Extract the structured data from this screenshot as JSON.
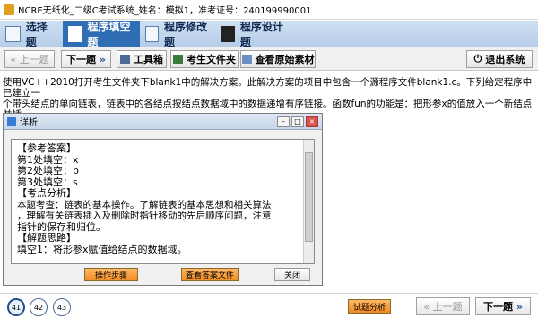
{
  "window": {
    "title": "NCRE无纸化_二级C考试系统_姓名：模拟1，准考证号：240199990001"
  },
  "tabs": [
    {
      "label": "选择题",
      "active": false
    },
    {
      "label": "程序填空题",
      "active": true
    },
    {
      "label": "程序修改题",
      "active": false
    },
    {
      "label": "程序设计题",
      "active": false
    }
  ],
  "toolbar": {
    "prev_label": "上一题",
    "next_label": "下一题",
    "toolbox_label": "工具箱",
    "student_folder_label": "考生文件夹",
    "view_source_label": "查看原始素材",
    "exit_label": "退出系统"
  },
  "problem": {
    "line1": "使用VC++2010打开考生文件夹下blank1中的解决方案。此解决方案的项目中包含一个源程序文件blank1.c。下列给定程序中已建立一",
    "line2": "个带头结点的单向链表，链表中的各结点按结点数据域中的数据递增有序链接。函数fun的功能是：把形参x的值放入一个新结点并插",
    "line3": "入链表中，使插入后各结点数据域中的数据仍保持递增有序。"
  },
  "dialog": {
    "title": "详析",
    "lines": [
      "【参考答案】",
      "第1处填空：x",
      "第2处填空：p",
      "第3处填空：s",
      "【考点分析】",
      "本题考查：链表的基本操作。了解链表的基本思想和相关算法",
      "，理解有关链表插入及删除时指针移动的先后顺序问题，注意",
      "指针的保存和归位。",
      "【解题思路】",
      "填空1：将形参x赋值给结点的数据域。"
    ],
    "steps_label": "操作步骤",
    "view_answer_label": "查看答案文件",
    "close_label": "关闭"
  },
  "bottom": {
    "pages": [
      "41",
      "42",
      "43"
    ],
    "current_page": "41",
    "analysis_label": "试题分析",
    "prev_label": "上一题",
    "next_label": "下一题"
  },
  "colors": {
    "accent": "#2f6db5",
    "orange_button": "#f08a24"
  }
}
